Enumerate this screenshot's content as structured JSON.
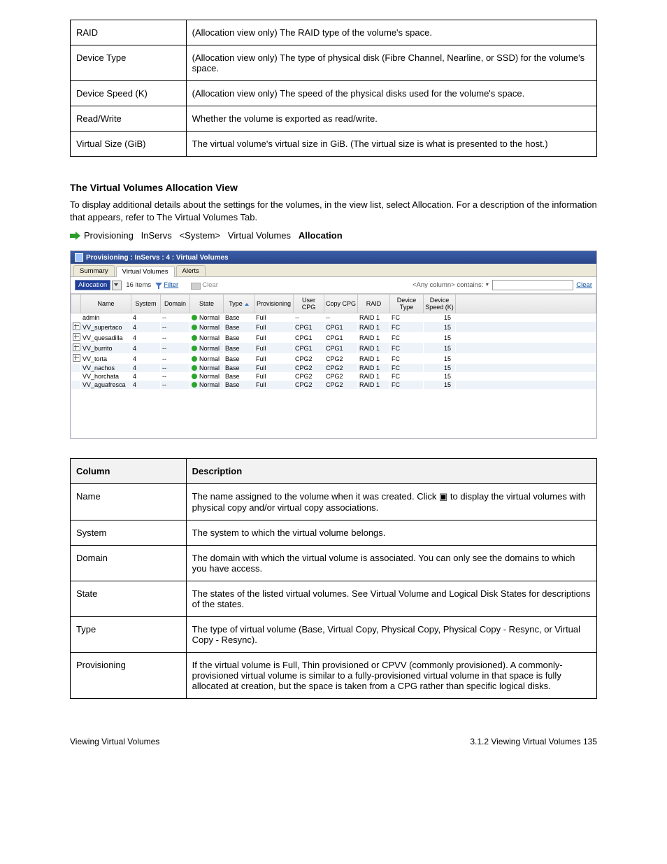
{
  "intro_table_rows": [
    {
      "label": "RAID",
      "desc": "(Allocation view only) The RAID type of the volume's space."
    },
    {
      "label": "Device Type",
      "desc": "(Allocation view only) The type of physical disk (Fibre Channel, Nearline, or SSD) for the volume's space."
    },
    {
      "label": "Device Speed (K)",
      "desc": "(Allocation view only) The speed of the physical disks used for the volume's space."
    },
    {
      "label": "Read/Write",
      "desc": "Whether the volume is exported as read/write."
    },
    {
      "label": "Virtual Size (GiB)",
      "desc": "The virtual volume's virtual size in GiB. (The virtual size is what is presented to the host.)"
    }
  ],
  "section_title": "The Virtual Volumes Allocation View",
  "section_para": "To display additional details about the settings for the volumes, in the view list, select Allocation. For a description of the information that appears, refer to The Virtual Volumes Tab.",
  "nav_text": "Provisioning&nbsp;&nbsp;InServs&nbsp;&nbsp;<System>&nbsp;&nbsp;Virtual Volumes&nbsp;&nbsp;",
  "nav_bold": "Allocation",
  "shot": {
    "title": "Provisioning : InServs : 4 : Virtual Volumes",
    "tabs": [
      "Summary",
      "Virtual Volumes",
      "Alerts"
    ],
    "active_tab": 1,
    "combo_value": "Allocation",
    "item_count": "16 items",
    "filter_label": "Filter",
    "clear_label": "Clear",
    "search_scope": "<Any column> contains:",
    "search_clear": "Clear",
    "columns": [
      "Name",
      "System",
      "Domain",
      "State",
      "Type",
      "Provisioning",
      "User CPG",
      "Copy CPG",
      "RAID",
      "Device Type",
      "Device Speed (K)"
    ],
    "sorted_col_index": 4,
    "rows": [
      {
        "exp": false,
        "name": "admin",
        "system": "4",
        "domain": "--",
        "state": "Normal",
        "type": "Base",
        "prov": "Full",
        "ucpg": "--",
        "ccpg": "--",
        "raid": "RAID 1",
        "dtype": "FC",
        "spd": "15"
      },
      {
        "exp": true,
        "name": "VV_supertaco",
        "system": "4",
        "domain": "--",
        "state": "Normal",
        "type": "Base",
        "prov": "Full",
        "ucpg": "CPG1",
        "ccpg": "CPG1",
        "raid": "RAID 1",
        "dtype": "FC",
        "spd": "15"
      },
      {
        "exp": true,
        "name": "VV_quesadilla",
        "system": "4",
        "domain": "--",
        "state": "Normal",
        "type": "Base",
        "prov": "Full",
        "ucpg": "CPG1",
        "ccpg": "CPG1",
        "raid": "RAID 1",
        "dtype": "FC",
        "spd": "15"
      },
      {
        "exp": true,
        "name": "VV_burrito",
        "system": "4",
        "domain": "--",
        "state": "Normal",
        "type": "Base",
        "prov": "Full",
        "ucpg": "CPG1",
        "ccpg": "CPG1",
        "raid": "RAID 1",
        "dtype": "FC",
        "spd": "15"
      },
      {
        "exp": true,
        "name": "VV_torta",
        "system": "4",
        "domain": "--",
        "state": "Normal",
        "type": "Base",
        "prov": "Full",
        "ucpg": "CPG2",
        "ccpg": "CPG2",
        "raid": "RAID 1",
        "dtype": "FC",
        "spd": "15"
      },
      {
        "exp": false,
        "name": "VV_nachos",
        "system": "4",
        "domain": "--",
        "state": "Normal",
        "type": "Base",
        "prov": "Full",
        "ucpg": "CPG2",
        "ccpg": "CPG2",
        "raid": "RAID 1",
        "dtype": "FC",
        "spd": "15"
      },
      {
        "exp": false,
        "name": "VV_horchata",
        "system": "4",
        "domain": "--",
        "state": "Normal",
        "type": "Base",
        "prov": "Full",
        "ucpg": "CPG2",
        "ccpg": "CPG2",
        "raid": "RAID 1",
        "dtype": "FC",
        "spd": "15"
      },
      {
        "exp": false,
        "name": "VV_aguafresca",
        "system": "4",
        "domain": "--",
        "state": "Normal",
        "type": "Base",
        "prov": "Full",
        "ucpg": "CPG2",
        "ccpg": "CPG2",
        "raid": "RAID 1",
        "dtype": "FC",
        "spd": "15"
      }
    ]
  },
  "spec2": {
    "header": [
      "Column",
      "Description"
    ],
    "rows": [
      {
        "label": "Name",
        "desc": "The name assigned to the volume when it was created. Click <span class='plus'>▣</span> to display the virtual volumes with physical copy and/or virtual copy associations."
      },
      {
        "label": "System",
        "desc": "The system to which the virtual volume belongs."
      },
      {
        "label": "Domain",
        "desc": "The domain with which the virtual volume is associated. You can only see the domains to which you have access."
      },
      {
        "label": "State",
        "desc": "The states of the listed virtual volumes. See Virtual Volume and Logical Disk States for descriptions of the states."
      },
      {
        "label": "Type",
        "desc": "The type of virtual volume (Base, Virtual Copy, Physical Copy, Physical Copy - Resync, or Virtual Copy - Resync)."
      },
      {
        "label": "Provisioning",
        "desc": "If the virtual volume is Full, Thin provisioned or CPVV (commonly provisioned). A commonly-provisioned virtual volume is similar to a fully-provisioned virtual volume in that space is fully allocated at creation, but the space is taken from a CPG rather than specific logical disks."
      }
    ]
  },
  "footer_left": "Viewing Virtual Volumes",
  "footer_right": "3.1.2 Viewing Virtual Volumes 135"
}
